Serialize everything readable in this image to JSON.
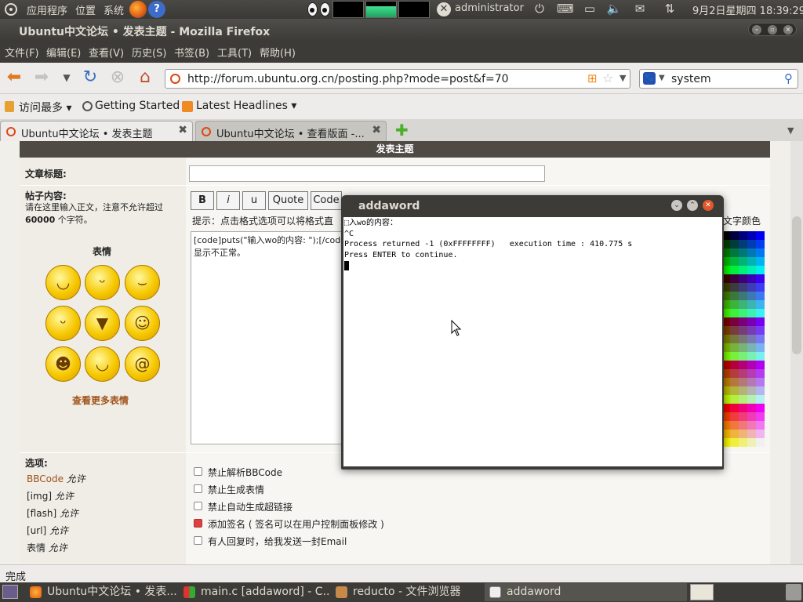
{
  "top_panel": {
    "apps_label": "应用程序",
    "places_label": "位置",
    "system_label": "系统",
    "user_label": "administrator",
    "datetime": "9月2日星期四 18:39:29"
  },
  "firefox": {
    "window_title": "Ubuntu中文论坛 • 发表主题 - Mozilla Firefox",
    "menu": [
      "文件(F)",
      "编辑(E)",
      "查看(V)",
      "历史(S)",
      "书签(B)",
      "工具(T)",
      "帮助(H)"
    ],
    "url": "http://forum.ubuntu.org.cn/posting.php?mode=post&f=70",
    "search_value": "system",
    "bookmarks": [
      "访问最多",
      "Getting Started",
      "Latest Headlines"
    ],
    "tabs": [
      {
        "label": "Ubuntu中文论坛 • 发表主题",
        "active": true
      },
      {
        "label": "Ubuntu中文论坛 • 查看版面 -...",
        "active": false
      }
    ],
    "status": "完成"
  },
  "form": {
    "header": "发表主题",
    "subject_label": "文章标题:",
    "subject_value": "",
    "body_label": "帖子内容:",
    "body_hint_1": "请在这里输入正文，注意不允许超过",
    "body_hint_2": "60000",
    "body_hint_3": "个字符。",
    "smilies_label": "表情",
    "more_smilies": "查看更多表情",
    "format_buttons": [
      "B",
      "i",
      "u",
      "Quote",
      "Code"
    ],
    "format_tip": "提示：点击格式选项可以将格式直",
    "color_label": "文字颜色",
    "body_line_1": "[code]puts(\"输入wo的内容: \");[/cod",
    "body_line_2": "显示不正常。",
    "options_label": "选项:",
    "options": [
      {
        "name": "BBCode",
        "state": "允许"
      },
      {
        "name": "[img]",
        "state": "允许"
      },
      {
        "name": "[flash]",
        "state": "允许"
      },
      {
        "name": "[url]",
        "state": "允许"
      },
      {
        "name": "表情",
        "state": "允许"
      }
    ],
    "checkboxes": [
      {
        "label": "禁止解析BBCode",
        "checked": false
      },
      {
        "label": "禁止生成表情",
        "checked": false
      },
      {
        "label": "禁止自动生成超链接",
        "checked": false
      },
      {
        "label": "添加签名 ( 签名可以在用户控制面板修改 )",
        "checked": true
      },
      {
        "label": "有人回复时，给我发送一封Email",
        "checked": false
      }
    ]
  },
  "dialog": {
    "title": "addaword",
    "lines": [
      "⬚入wo的内容：",
      "^C",
      "Process returned -1 (0xFFFFFFFF)   execution time : 410.775 s",
      "Press ENTER to continue."
    ]
  },
  "taskbar": {
    "tasks": [
      {
        "label": "Ubuntu中文论坛 • 发表...",
        "active": false
      },
      {
        "label": "main.c [addaword] - C...",
        "active": false
      },
      {
        "label": "reducto - 文件浏览器",
        "active": false
      },
      {
        "label": "addaword",
        "active": true
      }
    ]
  },
  "colors": {
    "ubuntu_orange": "#dd4814",
    "panel_bg": "#3c3b37",
    "form_header": "#4f4a44",
    "link_brown": "#a0521a"
  },
  "icons": [
    "ubuntu-logo-icon",
    "firefox-icon",
    "help-icon",
    "xeyes-icon",
    "user-status-icon",
    "power-icon",
    "keyboard-icon",
    "display-icon",
    "volume-icon",
    "mail-icon",
    "network-icon",
    "back-icon",
    "forward-icon",
    "reload-icon",
    "stop-icon",
    "home-icon",
    "rss-icon",
    "star-icon",
    "search-icon",
    "new-tab-icon",
    "close-tab-icon"
  ]
}
